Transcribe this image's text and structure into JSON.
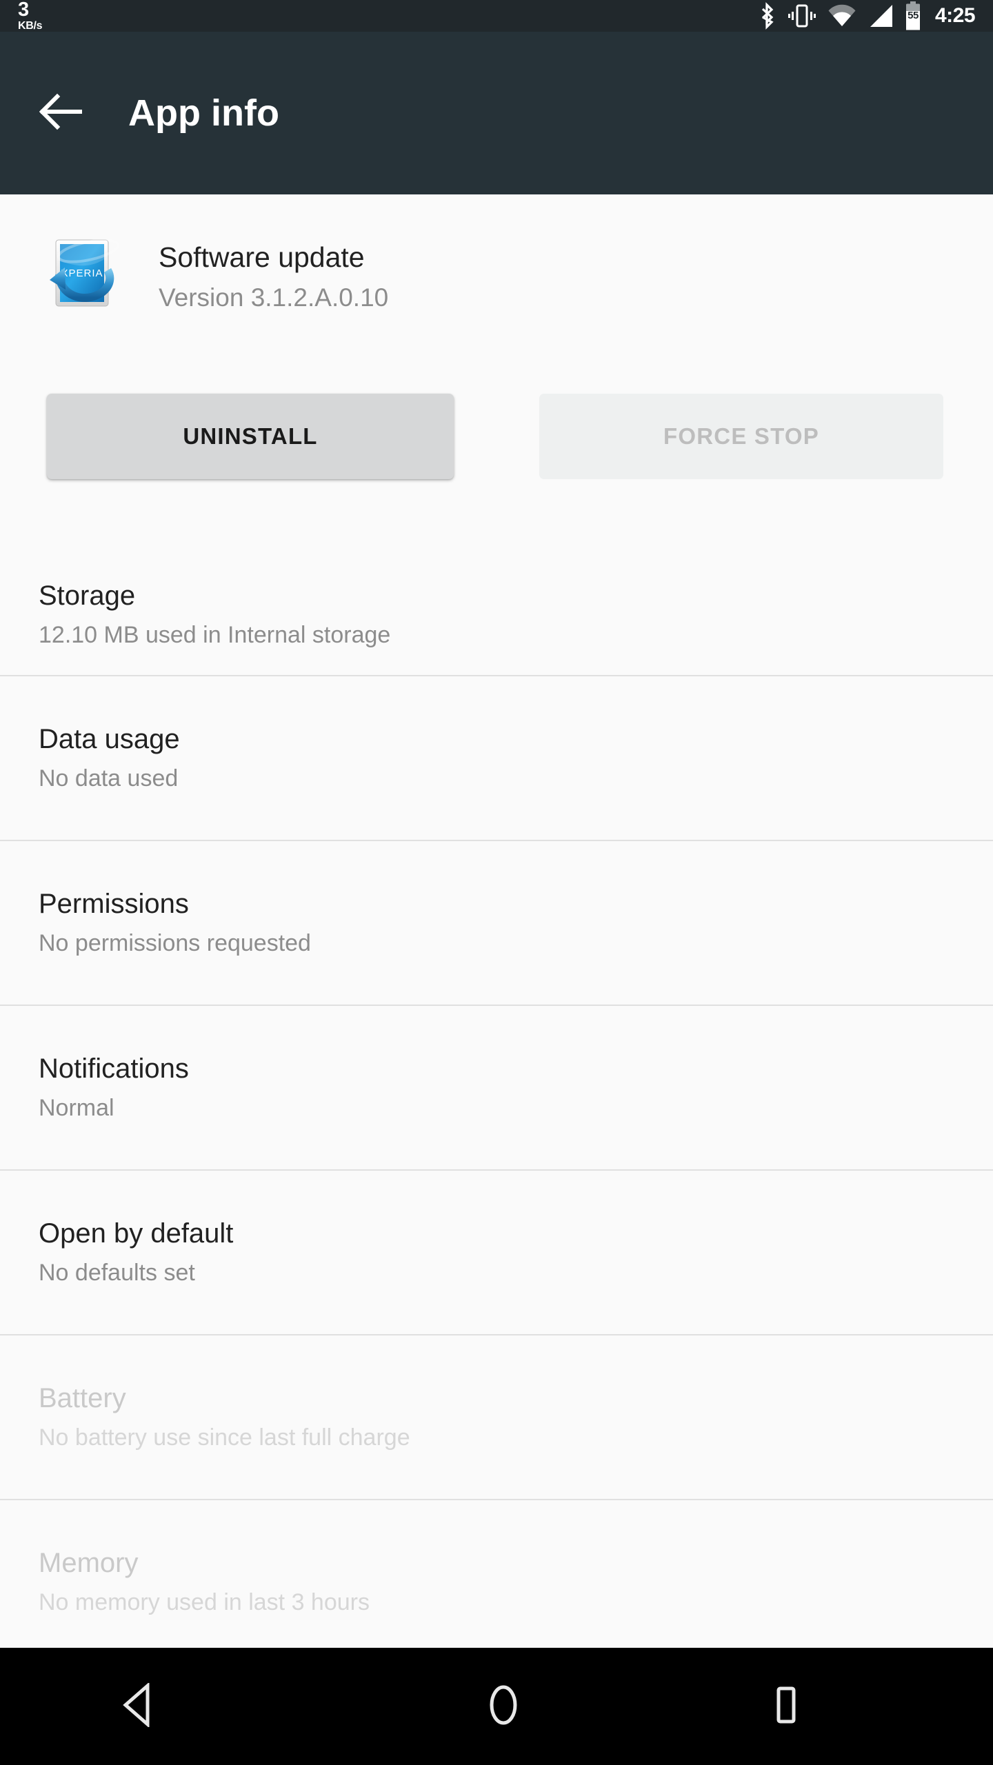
{
  "status_bar": {
    "network_speed_value": "3",
    "network_speed_unit": "KB/s",
    "icons": [
      "bluetooth-icon",
      "vibrate-icon",
      "wifi-icon",
      "cellular-signal-icon",
      "battery-icon"
    ],
    "battery_level": "55",
    "clock": "4:25"
  },
  "app_bar": {
    "back_icon": "arrow-back-icon",
    "title": "App info"
  },
  "app_header": {
    "icon_name": "xperia-software-update-icon",
    "icon_label": "XPERIA",
    "name": "Software update",
    "version": "Version 3.1.2.A.0.10"
  },
  "actions": {
    "uninstall_label": "UNINSTALL",
    "force_stop_label": "FORCE STOP"
  },
  "list": {
    "items": [
      {
        "title": "Storage",
        "subtitle": "12.10 MB used in Internal storage",
        "disabled": false
      },
      {
        "title": "Data usage",
        "subtitle": "No data used",
        "disabled": false
      },
      {
        "title": "Permissions",
        "subtitle": "No permissions requested",
        "disabled": false
      },
      {
        "title": "Notifications",
        "subtitle": "Normal",
        "disabled": false
      },
      {
        "title": "Open by default",
        "subtitle": "No defaults set",
        "disabled": false
      },
      {
        "title": "Battery",
        "subtitle": "No battery use since last full charge",
        "disabled": true
      },
      {
        "title": "Memory",
        "subtitle": "No memory used in last 3 hours",
        "disabled": true
      }
    ]
  },
  "nav_bar": {
    "back": "nav-back-icon",
    "home": "nav-home-icon",
    "recents": "nav-recents-icon"
  },
  "colors": {
    "app_bar": "#263238",
    "status_bar": "#21282c",
    "content_bg": "#fafafa",
    "nav_bar": "#000000",
    "primary_text": "#212121",
    "secondary_text": "#8c8c8c",
    "disabled_text": "#c9c9c9",
    "divider": "#e0e0e0",
    "uninstall_button": "#d6d7d8",
    "force_stop_button": "#eef0f0"
  }
}
